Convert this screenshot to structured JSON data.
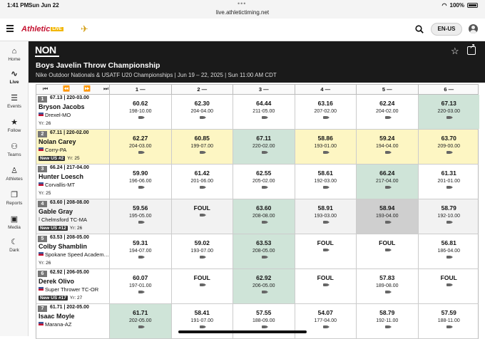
{
  "status": {
    "time": "1:41 PM",
    "date": "Sun Jun 22",
    "url": "live.athletictiming.net",
    "battery": "100%"
  },
  "nav": {
    "brand": "Athletic",
    "brand_live": "LIVE",
    "language": "EN-US"
  },
  "sidebar": {
    "items": [
      {
        "label": "Home",
        "icon": "home-icon"
      },
      {
        "label": "Live",
        "icon": "pulse-icon"
      },
      {
        "label": "Events",
        "icon": "list-icon"
      },
      {
        "label": "Follow",
        "icon": "star-icon"
      },
      {
        "label": "Teams",
        "icon": "teams-icon"
      },
      {
        "label": "Athletes",
        "icon": "athlete-icon"
      },
      {
        "label": "Reports",
        "icon": "reports-icon"
      },
      {
        "label": "Media",
        "icon": "media-icon"
      },
      {
        "label": "Dark",
        "icon": "moon-icon"
      }
    ]
  },
  "event": {
    "logo": "NON",
    "title": "Boys Javelin Throw Championship",
    "subtitle": "Nike Outdoor Nationals & USATF U20 Championships | Jun 19 – 22, 2025 | Sun 11:00 AM CDT"
  },
  "columns": [
    "1 —",
    "2 —",
    "3 —",
    "4 —",
    "5 —",
    "6 —"
  ],
  "athletes": [
    {
      "place": "1",
      "bests": "67.13 | 220-03.00",
      "name": "Bryson Jacobs",
      "team": "Drexel-MO",
      "badge": "",
      "year": "Yr: 26",
      "style": "",
      "marks": [
        [
          "60.62",
          "198-10.00",
          ""
        ],
        [
          "62.30",
          "204-04.00",
          ""
        ],
        [
          "64.44",
          "211-05.00",
          ""
        ],
        [
          "63.16",
          "207-02.00",
          ""
        ],
        [
          "62.24",
          "204-02.00",
          ""
        ],
        [
          "67.13",
          "220-03.00",
          "best"
        ]
      ]
    },
    {
      "place": "2",
      "bests": "67.11 | 220-02.00",
      "name": "Nolan Carey",
      "team": "Corry-PA",
      "badge": "New US #2",
      "year": "Yr: 25",
      "style": "hl",
      "marks": [
        [
          "62.27",
          "204-03.00",
          ""
        ],
        [
          "60.85",
          "199-07.00",
          ""
        ],
        [
          "67.11",
          "220-02.00",
          "best"
        ],
        [
          "58.86",
          "193-01.00",
          ""
        ],
        [
          "59.24",
          "194-04.00",
          ""
        ],
        [
          "63.70",
          "209-00.00",
          ""
        ]
      ]
    },
    {
      "place": "3",
      "bests": "66.24 | 217-04.00",
      "name": "Hunter Loesch",
      "team": "Corvallis-MT",
      "badge": "",
      "year": "Yr: 25",
      "style": "",
      "marks": [
        [
          "59.90",
          "196-06.00",
          ""
        ],
        [
          "61.42",
          "201-06.00",
          ""
        ],
        [
          "62.55",
          "205-02.00",
          ""
        ],
        [
          "58.61",
          "192-03.00",
          ""
        ],
        [
          "66.24",
          "217-04.00",
          "best"
        ],
        [
          "61.31",
          "201-01.00",
          ""
        ]
      ]
    },
    {
      "place": "4",
      "bests": "63.60 | 208-08.00",
      "name": "Gable Gray",
      "team": "Chelmsford TC-MA",
      "badge": "New US #12",
      "year": "Yr: 26",
      "style": "alt",
      "marks": [
        [
          "59.56",
          "195-05.00",
          ""
        ],
        [
          "FOUL",
          "",
          ""
        ],
        [
          "63.60",
          "208-08.00",
          "best"
        ],
        [
          "58.91",
          "193-03.00",
          ""
        ],
        [
          "58.94",
          "193-04.00",
          "grey"
        ],
        [
          "58.79",
          "192-10.00",
          ""
        ]
      ]
    },
    {
      "place": "5",
      "bests": "63.53 | 208-05.00",
      "name": "Colby Shamblin",
      "team": "Spokane Speed Academ…",
      "badge": "",
      "year": "Yr: 26",
      "style": "",
      "marks": [
        [
          "59.31",
          "194-07.00",
          ""
        ],
        [
          "59.02",
          "193-07.00",
          ""
        ],
        [
          "63.53",
          "208-05.00",
          "best"
        ],
        [
          "FOUL",
          "",
          ""
        ],
        [
          "FOUL",
          "",
          ""
        ],
        [
          "56.81",
          "186-04.00",
          ""
        ]
      ]
    },
    {
      "place": "6",
      "bests": "62.92 | 206-05.00",
      "name": "Derek Olivo",
      "team": "Super Thrower TC-OR",
      "badge": "New US #17",
      "year": "Yr: 27",
      "style": "",
      "marks": [
        [
          "60.07",
          "197-01.00",
          ""
        ],
        [
          "FOUL",
          "",
          ""
        ],
        [
          "62.92",
          "206-05.00",
          "best"
        ],
        [
          "FOUL",
          "",
          ""
        ],
        [
          "57.83",
          "189-08.00",
          ""
        ],
        [
          "FOUL",
          "",
          ""
        ]
      ]
    },
    {
      "place": "7",
      "bests": "61.71 | 202-05.00",
      "name": "Isaac Moyle",
      "team": "Marana-AZ",
      "badge": "",
      "year": "",
      "style": "",
      "marks": [
        [
          "61.71",
          "202-05.00",
          "best"
        ],
        [
          "58.41",
          "191-07.00",
          ""
        ],
        [
          "57.55",
          "188-09.00",
          ""
        ],
        [
          "54.07",
          "177-04.00",
          ""
        ],
        [
          "58.79",
          "192-11.00",
          ""
        ],
        [
          "57.59",
          "188-11.00",
          ""
        ]
      ]
    }
  ]
}
